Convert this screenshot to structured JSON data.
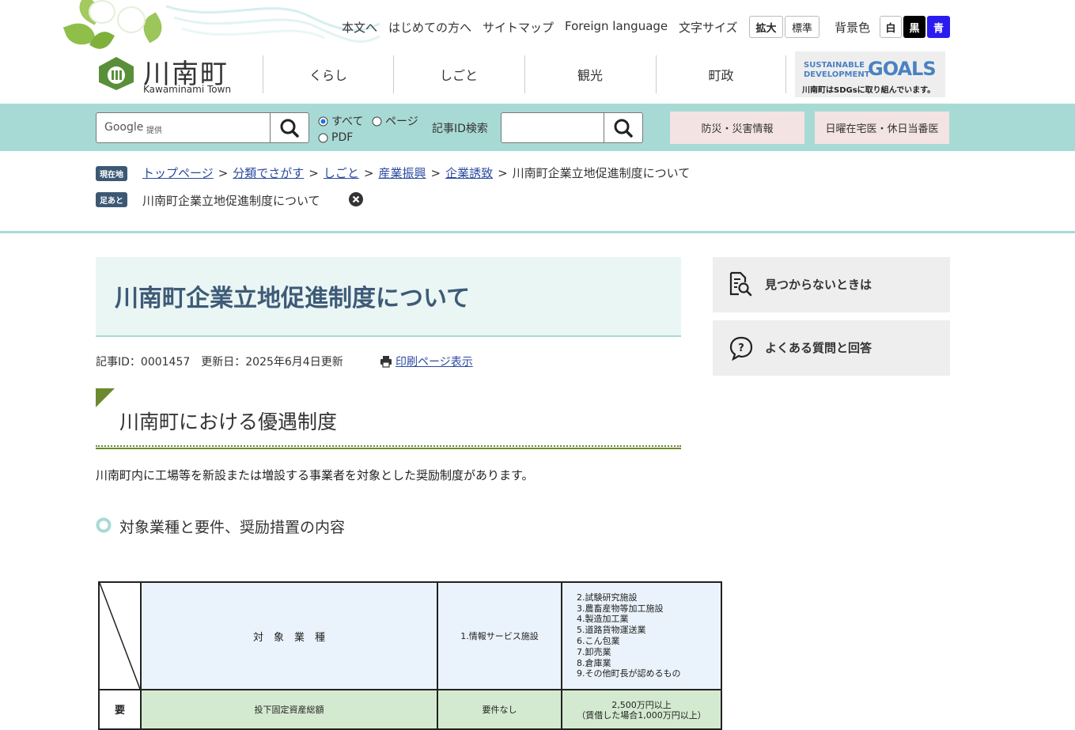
{
  "header": {
    "logo_text": "川南町",
    "logo_sub": "Kawaminami Town",
    "util_links": [
      "本文へ",
      "はじめての方へ",
      "サイトマップ",
      "Foreign language"
    ],
    "font_size_label": "文字サイズ",
    "font_size_buttons": [
      "拡大",
      "標準"
    ],
    "bg_color_label": "背景色",
    "bg_buttons": [
      {
        "label": "白",
        "bg": "#ffffff",
        "fg": "#000000"
      },
      {
        "label": "黒",
        "bg": "#000000",
        "fg": "#ffffff"
      },
      {
        "label": "青",
        "bg": "#2a1cf0",
        "fg": "#ffffff"
      }
    ],
    "nav": [
      "くらし",
      "しごと",
      "観光",
      "町政"
    ],
    "sdgs": {
      "line1": "SUSTAINABLE",
      "line2": "DEVELOPMENT",
      "goals": "GOALS",
      "caption": "川南町はSDGsに取り組んでいます。"
    }
  },
  "search": {
    "google_label": "Google",
    "google_sub": "提供",
    "radios": [
      "すべて",
      "ページ",
      "PDF"
    ],
    "article_id_label": "記事ID検索",
    "disaster_button": "防災・災害情報",
    "doctor_button": "日曜在宅医・休日当番医"
  },
  "breadcrumb": {
    "current_tag": "現在地",
    "items": [
      "トップページ",
      "分類でさがす",
      "しごと",
      "産業振興",
      "企業誘致"
    ],
    "current": "川南町企業立地促進制度について",
    "history_tag": "足あと",
    "history_item": "川南町企業立地促進制度について"
  },
  "article": {
    "title": "川南町企業立地促進制度について",
    "meta": "記事ID：0001457　更新日：2025年6月4日更新",
    "print_link": "印刷ページ表示",
    "h2": "川南町における優遇制度",
    "intro": "川南町内に工場等を新設または増設する事業者を対象とした奨励制度があります。",
    "h3": "対象業種と要件、奨励措置の内容"
  },
  "table": {
    "header_label": "対　象　業　種",
    "col1": "1.情報サービス施設",
    "col2_items": [
      "2.試験研究施設",
      "3.農畜産物等加工施設",
      "4.製造加工業",
      "5.道路貨物運送業",
      "6.こん包業",
      "7.卸売業",
      "8.倉庫業",
      "9.その他町長が認めるもの"
    ],
    "row2_head": "要",
    "row2_label": "投下固定資産総額",
    "row2_col1": "要件なし",
    "row2_col2_line1": "2,500万円以上",
    "row2_col2_line2": "（賃借した場合1,000万円以上）"
  },
  "sidebar": {
    "not_found": "見つからないときは",
    "faq": "よくある質問と回答"
  },
  "colors": {
    "band": "#a8dad5",
    "title_text": "#3e5a77",
    "link": "#2a4aa0",
    "tag": "#3c5873",
    "olive": "#6b8a2e",
    "table_green": "#d4ead0",
    "table_blue": "#eaf3fb"
  }
}
